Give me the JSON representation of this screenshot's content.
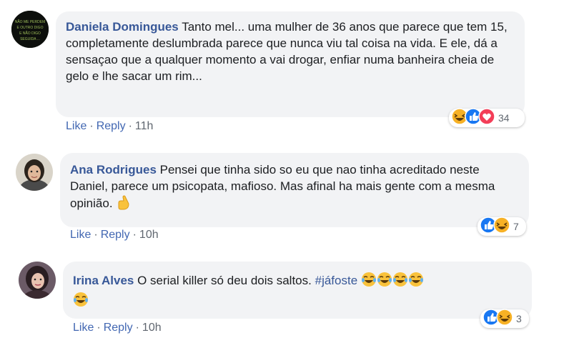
{
  "comments": [
    {
      "author": "Daniela Domingues",
      "text": "Tanto mel... uma mulher de 36 anos que parece que tem 15, completamente deslumbrada parece que nunca viu tal coisa na vida. E ele, dá a sensaçao que a qualquer momento a vai drogar, enfiar numa banheira cheia de gelo e lhe sacar um rim...",
      "avatar_text": "NÃO ME PERDEM E OUTRO DIGO E NÃO DIGO SEGUIDA ...",
      "like": "Like",
      "reply": "Reply",
      "time": "11h",
      "reactions": [
        "haha-icon",
        "like-icon",
        "love-icon"
      ],
      "reaction_count": "34"
    },
    {
      "author": "Ana Rodrigues",
      "text": "Pensei que tinha sido so eu que nao tinha acreditado neste Daniel, parece um psicopata, mafioso. Mas afinal ha mais gente com a mesma opinião.",
      "like": "Like",
      "reply": "Reply",
      "time": "10h",
      "reactions": [
        "like-icon",
        "haha-icon"
      ],
      "reaction_count": "7"
    },
    {
      "author": "Irina Alves",
      "text": "O serial killer só deu dois saltos.",
      "hashtag": "#jáfoste",
      "like": "Like",
      "reply": "Reply",
      "time": "10h",
      "reactions": [
        "like-icon",
        "haha-icon"
      ],
      "reaction_count": "3"
    }
  ],
  "colors": {
    "link": "#385898",
    "action": "#4267b2",
    "bubble": "#f2f3f5",
    "like_blue": "#1877f2",
    "love_red": "#f33e58",
    "haha_yellow": "#f7b125"
  }
}
